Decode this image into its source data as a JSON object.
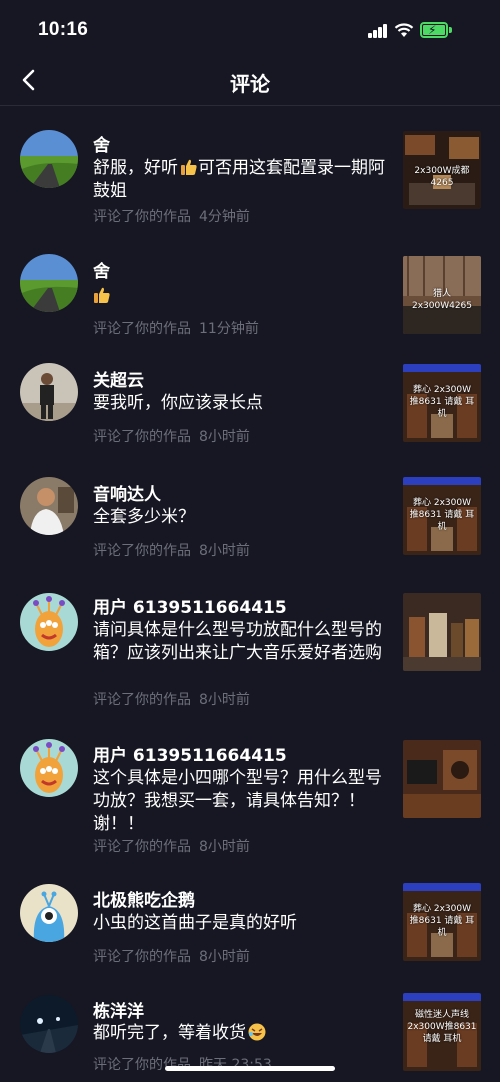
{
  "status": {
    "time": "10:16"
  },
  "nav": {
    "title": "评论"
  },
  "comments": [
    {
      "name": "舍",
      "text": "舒服，好听",
      "text_tail": "可否用这套配置录一期阿鼓姐",
      "action": "评论了你的作品",
      "time": "4分钟前",
      "thumb_text": "2x300W成都4265"
    },
    {
      "name": "舍",
      "text": "",
      "action": "评论了你的作品",
      "time": "11分钟前",
      "thumb_text": "猎人2x300W4265"
    },
    {
      "name": "关超云",
      "text": "要我听，你应该录长点",
      "action": "评论了你的作品",
      "time": "8小时前",
      "thumb_text": "葬心 2x300W推8631 请戴 耳机"
    },
    {
      "name": "音响达人",
      "text": "全套多少米？",
      "action": "评论了你的作品",
      "time": "8小时前",
      "thumb_text": "葬心 2x300W推8631 请戴 耳机"
    },
    {
      "name": "用户 6139511664415",
      "text": "请问具体是什么型号功放配什么型号的箱？应该列出来让广大音乐爱好者选购",
      "action": "评论了你的作品",
      "time": "8小时前",
      "thumb_text": ""
    },
    {
      "name": "用户 6139511664415",
      "text": "这个具体是小四哪个型号？用什么型号功放？我想买一套，请具体告知？！谢！！",
      "action": "评论了你的作品",
      "time": "8小时前",
      "thumb_text": ""
    },
    {
      "name": "北极熊吃企鹅",
      "text": "小虫的这首曲子是真的好听",
      "action": "评论了你的作品",
      "time": "8小时前",
      "thumb_text": "葬心 2x300W推8631 请戴 耳机"
    },
    {
      "name": "栋洋洋",
      "text": "都听完了，等着收货",
      "action": "评论了你的作品",
      "time": "昨天 23:53",
      "thumb_text": "磁性迷人声线 2x300W推8631 请戴 耳机"
    }
  ],
  "colors": {
    "background": "#161722",
    "secondary_text": "#6c6e7a",
    "battery": "#4cd964"
  }
}
